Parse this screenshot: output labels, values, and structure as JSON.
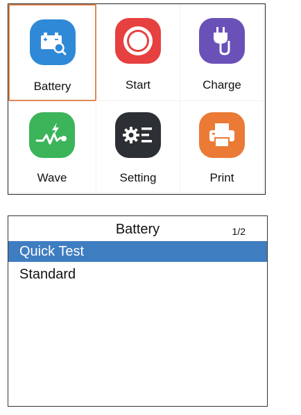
{
  "main_menu": {
    "tiles": [
      {
        "label": "Battery",
        "icon": "battery-search-icon",
        "color": "#2f89d6",
        "selected": true
      },
      {
        "label": "Start",
        "icon": "start-circle-icon",
        "color": "#e64040",
        "selected": false
      },
      {
        "label": "Charge",
        "icon": "plug-icon",
        "color": "#6a51b8",
        "selected": false
      },
      {
        "label": "Wave",
        "icon": "wave-icon",
        "color": "#3bb45a",
        "selected": false
      },
      {
        "label": "Setting",
        "icon": "gear-settings-icon",
        "color": "#2c2f33",
        "selected": false
      },
      {
        "label": "Print",
        "icon": "printer-icon",
        "color": "#ea7a35",
        "selected": false
      }
    ],
    "selection_color": "#e08752"
  },
  "battery_menu": {
    "title": "Battery",
    "page": "1/2",
    "items": [
      {
        "label": "Quick Test",
        "selected": true
      },
      {
        "label": "Standard",
        "selected": false
      }
    ],
    "highlight_color": "#3f7dc1"
  }
}
